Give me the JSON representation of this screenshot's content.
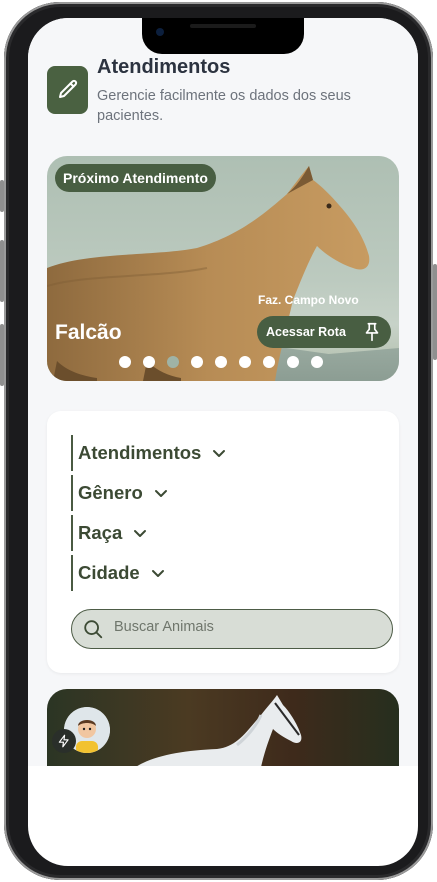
{
  "header": {
    "title": "Atendimentos",
    "subtitle": "Gerencie facilmente os dados dos seus pacientes."
  },
  "hero": {
    "badge": "Próximo Atendimento",
    "animal_name": "Falcão",
    "farm": "Faz. Campo Novo",
    "route_button": "Acessar Rota",
    "dots_total": 9,
    "active_dot_index": 2
  },
  "filters": [
    {
      "label": "Atendimentos"
    },
    {
      "label": "Gênero"
    },
    {
      "label": "Raça"
    },
    {
      "label": "Cidade"
    }
  ],
  "search": {
    "placeholder": "Buscar Animais"
  },
  "icons": {
    "header": "pencil-icon",
    "route": "pin-icon",
    "search": "search-icon",
    "filter": "chevron-down-icon",
    "badge": "lightning-icon"
  },
  "colors": {
    "brand_green": "#485e42",
    "background": "#f6f7f9",
    "text_dark": "#2c3340",
    "text_muted": "#6d737c"
  }
}
